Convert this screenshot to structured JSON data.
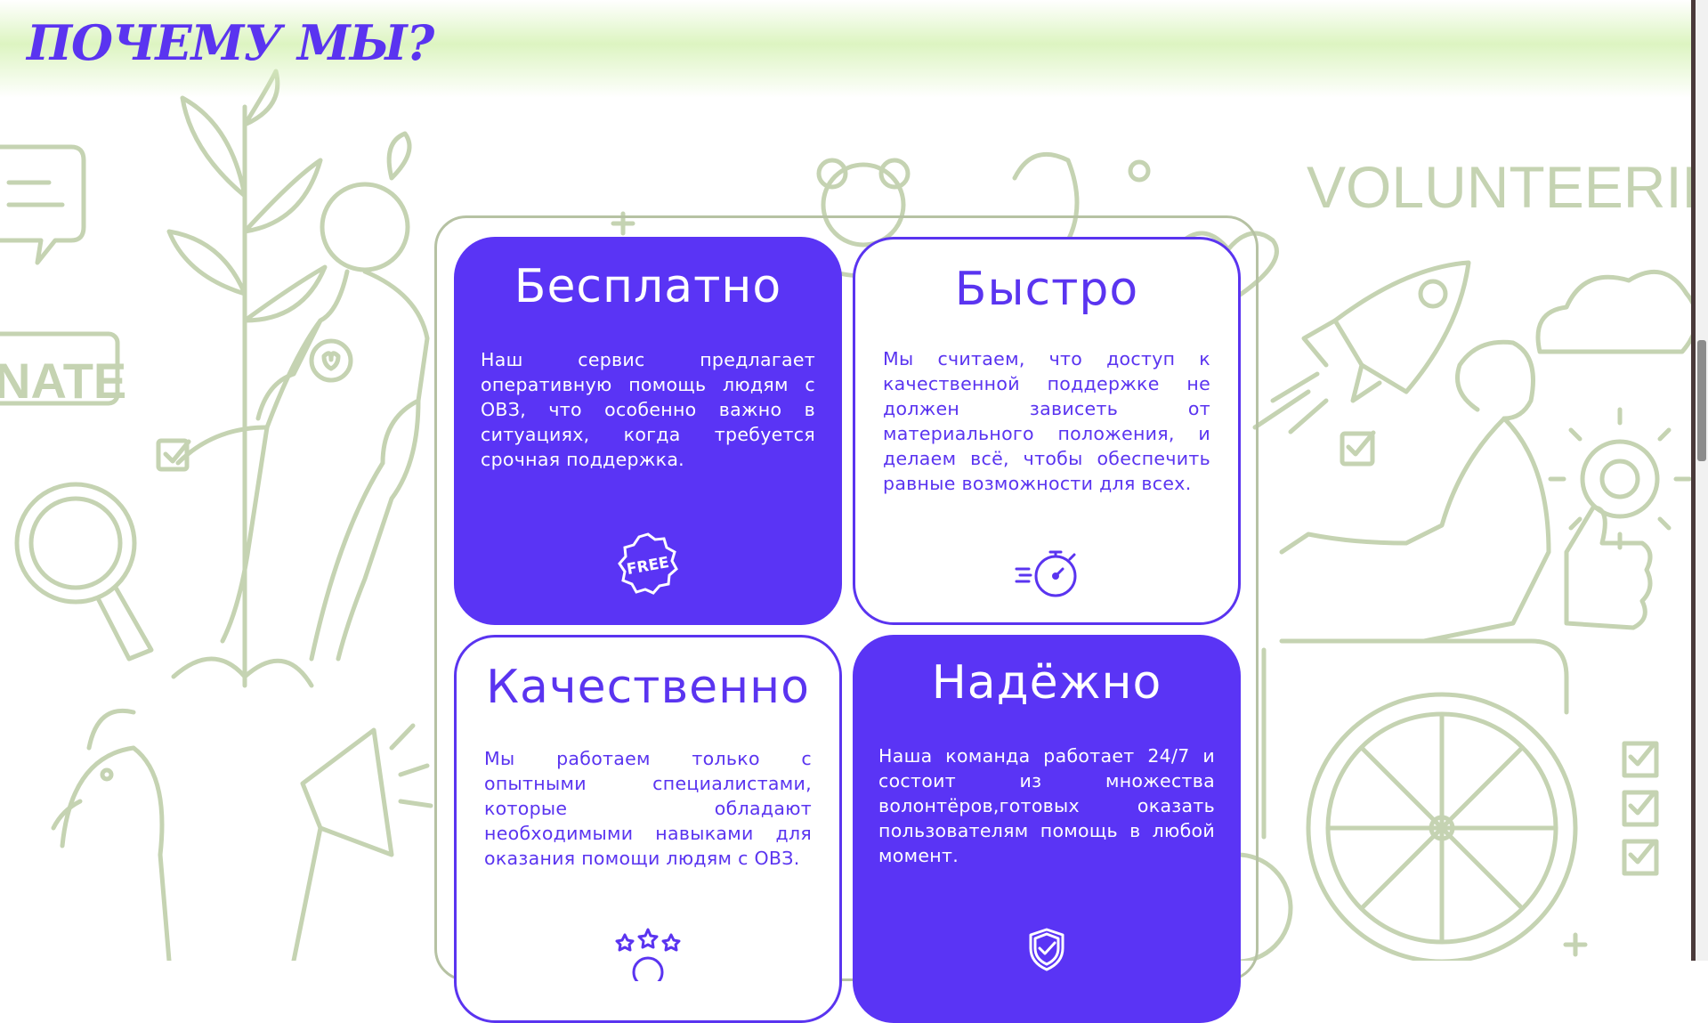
{
  "page": {
    "title": "ПОЧЕМУ МЫ?"
  },
  "background": {
    "banner_left": "NATE",
    "banner_right": "VOLUNTEERING"
  },
  "features": [
    {
      "title": "Бесплатно",
      "text": "Наш сервис предлагает оперативную помощь людям с ОВЗ, что особенно важно в ситуациях, когда требуется срочная поддержка.",
      "icon": "free-badge-icon",
      "badge_text": "FREE",
      "style": "filled"
    },
    {
      "title": "Быстро",
      "text": "Мы считаем, что доступ к качественной поддержке не должен зависеть от материального положения, и делаем всё, чтобы обеспечить равные возможности для всех.",
      "icon": "stopwatch-icon",
      "style": "outline"
    },
    {
      "title": "Качественно",
      "text": "Мы работаем только с опытными специалистами, которые обладают необходимыми навыками для оказания помощи людям с ОВЗ.",
      "icon": "quality-medal-icon",
      "style": "outline"
    },
    {
      "title": "Надёжно",
      "text": "Наша команда работает 24/7 и состоит из множества волонтёров,готовых оказать пользователям помощь в любой момент.",
      "icon": "shield-check-icon",
      "style": "filled"
    }
  ],
  "colors": {
    "accent": "#5a34f5",
    "background_art": "#c5d3b2",
    "top_band": "#dbf4be",
    "frame_border": "#b6c2a3"
  }
}
